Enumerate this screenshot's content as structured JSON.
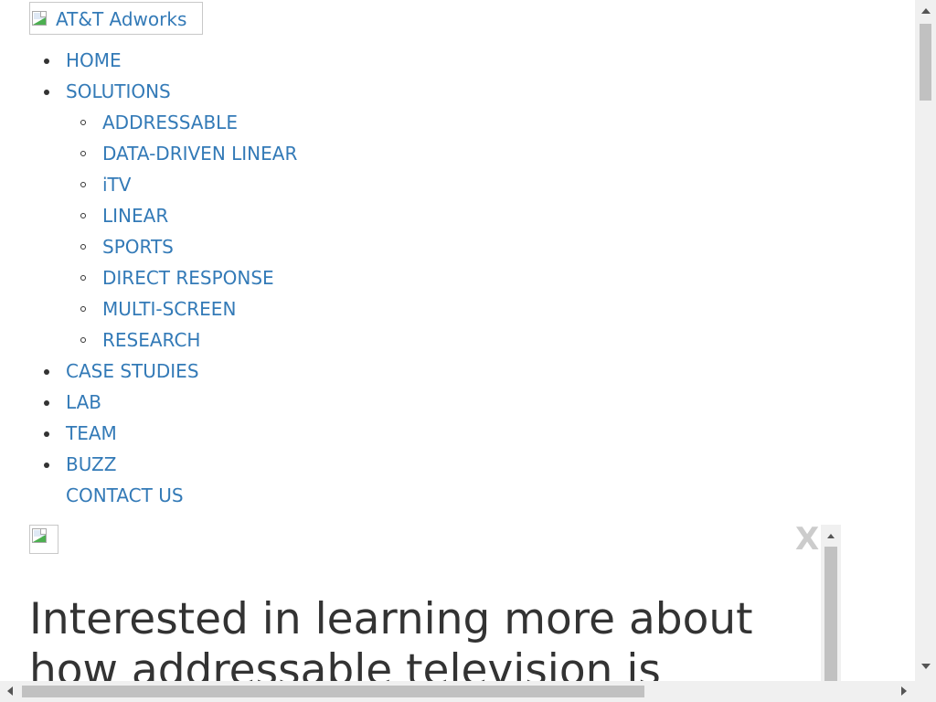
{
  "logo": {
    "alt_text": "AT&T Adworks"
  },
  "nav": {
    "items": [
      {
        "label": "HOME"
      },
      {
        "label": "SOLUTIONS",
        "children": [
          {
            "label": "ADDRESSABLE"
          },
          {
            "label": "DATA-DRIVEN LINEAR"
          },
          {
            "label": "iTV"
          },
          {
            "label": "LINEAR"
          },
          {
            "label": "SPORTS"
          },
          {
            "label": "DIRECT RESPONSE"
          },
          {
            "label": "MULTI-SCREEN"
          },
          {
            "label": "RESEARCH"
          }
        ]
      },
      {
        "label": "CASE STUDIES"
      },
      {
        "label": "LAB"
      },
      {
        "label": "TEAM"
      },
      {
        "label": "BUZZ"
      },
      {
        "label": "CONTACT US"
      }
    ]
  },
  "popup": {
    "close_label": "X",
    "heading": "Interested in learning more about how addressable television is"
  },
  "colors": {
    "link": "#337ab7",
    "text": "#333333",
    "close": "#cccccc",
    "scrollbar_track": "#f0f0f0",
    "scrollbar_thumb": "#c1c1c1"
  },
  "icons": {
    "logo_image": "broken-image-icon",
    "popup_image": "broken-image-icon",
    "close": "close-icon"
  }
}
